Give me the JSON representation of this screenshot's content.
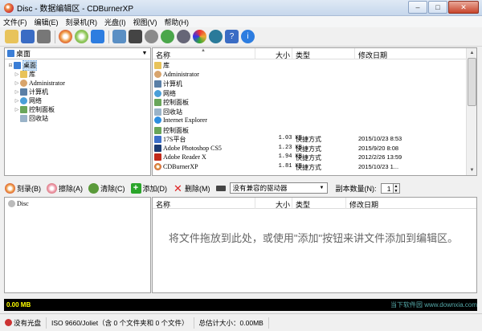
{
  "window": {
    "title": "Disc - 数据编辑区 - CDBurnerXP",
    "min_glyph": "–",
    "max_glyph": "□",
    "close_glyph": "✕"
  },
  "menu": [
    "文件(F)",
    "编辑(E)",
    "刻录机(R)",
    "光盘(I)",
    "视图(V)",
    "帮助(H)"
  ],
  "left_tree": {
    "location": "桌面",
    "items": [
      {
        "label": "桌面",
        "icon": "desktop-icon",
        "level": 0,
        "expander": "⊟"
      },
      {
        "label": "库",
        "icon": "library-folder-icon",
        "level": 1,
        "expander": "▷"
      },
      {
        "label": "Administrator",
        "icon": "user-folder-icon",
        "level": 1,
        "expander": "▷"
      },
      {
        "label": "计算机",
        "icon": "computer-icon",
        "level": 1,
        "expander": "▷"
      },
      {
        "label": "网络",
        "icon": "network-icon",
        "level": 1,
        "expander": "▷"
      },
      {
        "label": "控制面板",
        "icon": "control-panel-icon",
        "level": 1,
        "expander": "▷"
      },
      {
        "label": "回收站",
        "icon": "recycle-bin-icon",
        "level": 1,
        "expander": ""
      }
    ]
  },
  "file_list": {
    "headers": {
      "name": "名称",
      "size": "大小",
      "type": "类型",
      "date": "修改日期"
    },
    "rows": [
      {
        "name": "库",
        "size": "",
        "type": "",
        "date": "",
        "icon": "folder-icon"
      },
      {
        "name": "Administrator",
        "size": "",
        "type": "",
        "date": "",
        "icon": "user-folder-icon"
      },
      {
        "name": "计算机",
        "size": "",
        "type": "",
        "date": "",
        "icon": "computer-icon"
      },
      {
        "name": "网络",
        "size": "",
        "type": "",
        "date": "",
        "icon": "network-icon"
      },
      {
        "name": "控制面板",
        "size": "",
        "type": "",
        "date": "",
        "icon": "control-panel-icon"
      },
      {
        "name": "回收站",
        "size": "",
        "type": "",
        "date": "",
        "icon": "recycle-bin-icon"
      },
      {
        "name": "Internet Explorer",
        "size": "",
        "type": "",
        "date": "",
        "icon": "ie-icon"
      },
      {
        "name": "控制面板",
        "size": "",
        "type": "",
        "date": "",
        "icon": "control-panel-icon"
      },
      {
        "name": "17S平台",
        "size": "1.03 KB",
        "type": "快捷方式",
        "date": "2015/10/23 8:53",
        "icon": "app-icon"
      },
      {
        "name": "Adobe Photoshop CS5",
        "size": "1.23 KB",
        "type": "快捷方式",
        "date": "2015/9/20 8:08",
        "icon": "photoshop-icon"
      },
      {
        "name": "Adobe Reader X",
        "size": "1.94 KB",
        "type": "快捷方式",
        "date": "2012/2/26 13:59",
        "icon": "pdf-icon"
      },
      {
        "name": "CDBurnerXP",
        "size": "1.81 KB",
        "type": "快捷方式",
        "date": "2015/10/23 1...",
        "icon": "cdburner-icon"
      }
    ]
  },
  "burn_bar": {
    "burn": "刻录(B)",
    "erase": "擦除(A)",
    "clear": "清除(C)",
    "add": "添加(D)",
    "delete": "删除(M)",
    "drive": "没有兼容的驱动器",
    "copies_label": "副本数量(N):",
    "copies_value": "1"
  },
  "disc_tree": {
    "root": "Disc"
  },
  "disc_list": {
    "headers": {
      "name": "名称",
      "size": "大小",
      "type": "类型",
      "date": "修改日期"
    },
    "hint": "将文件拖放到此处，或使用\"添加\"按钮来讲文件添加到编辑区。"
  },
  "progress": {
    "label": "0.00 MB",
    "fraction": 0.0
  },
  "watermark": "当下软件园 www.downxia.com",
  "status": {
    "disc": "没有光盘",
    "fs": "ISO 9660/Joliet（含 0 个文件夹和 0 个文件）",
    "total": "总估计大小：0.00MB"
  },
  "colors": {
    "progress_text": "#ffff00",
    "title_bg": "#c6d7ec",
    "selection": "#cde4f9"
  }
}
